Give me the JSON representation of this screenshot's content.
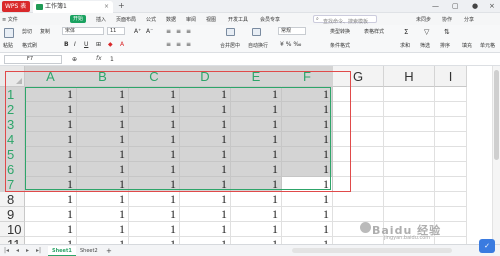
{
  "titlebar": {
    "app_label": "WPS 表格",
    "doc_tab": "工作簿1",
    "add_tab": "+"
  },
  "menu": {
    "items": [
      "≡ 文件",
      "开始",
      "插入",
      "页面布局",
      "公式",
      "数据",
      "审阅",
      "视图",
      "开发工具",
      "会员专享"
    ],
    "search_placeholder": "查找命令、搜索模板",
    "right_items": [
      "未同步",
      "协作",
      "分享"
    ]
  },
  "ribbon": {
    "paste": "粘贴",
    "cut": "剪切",
    "copy": "复制",
    "format_painter": "格式刷",
    "font_name": "宋体",
    "font_size": "11",
    "merge_center": "合并居中",
    "wrap_text": "自动换行",
    "number_format": "常规",
    "conditional_format": "条件格式",
    "cell_style": "表格样式",
    "sum": "求和",
    "filter": "筛选",
    "sort": "排序",
    "fill": "填充",
    "cells": "单元格",
    "row_col": "行和列",
    "type_convert": "类型转换"
  },
  "formula_bar": {
    "cell_ref": "F7",
    "fx": "fx",
    "value": "1"
  },
  "grid": {
    "columns": [
      "A",
      "B",
      "C",
      "D",
      "E",
      "F",
      "G",
      "H",
      "I"
    ],
    "rows": [
      "1",
      "2",
      "3",
      "4",
      "5",
      "6",
      "7",
      "8",
      "9",
      "10",
      "11"
    ],
    "cell_value": "1",
    "selection": "A1:F7",
    "active_cell": "F7"
  },
  "sheets": {
    "tabs": [
      "Sheet1",
      "Sheet2"
    ],
    "active": "Sheet1",
    "add": "+"
  },
  "watermark": {
    "text": "Baidu 经验",
    "sub": "jingyan.baidu.com"
  },
  "colors": {
    "accent": "#2ea56a",
    "selection_fill": "#d4d4d4",
    "annotation": "#e04a4a",
    "wps_red": "#d9292b"
  }
}
